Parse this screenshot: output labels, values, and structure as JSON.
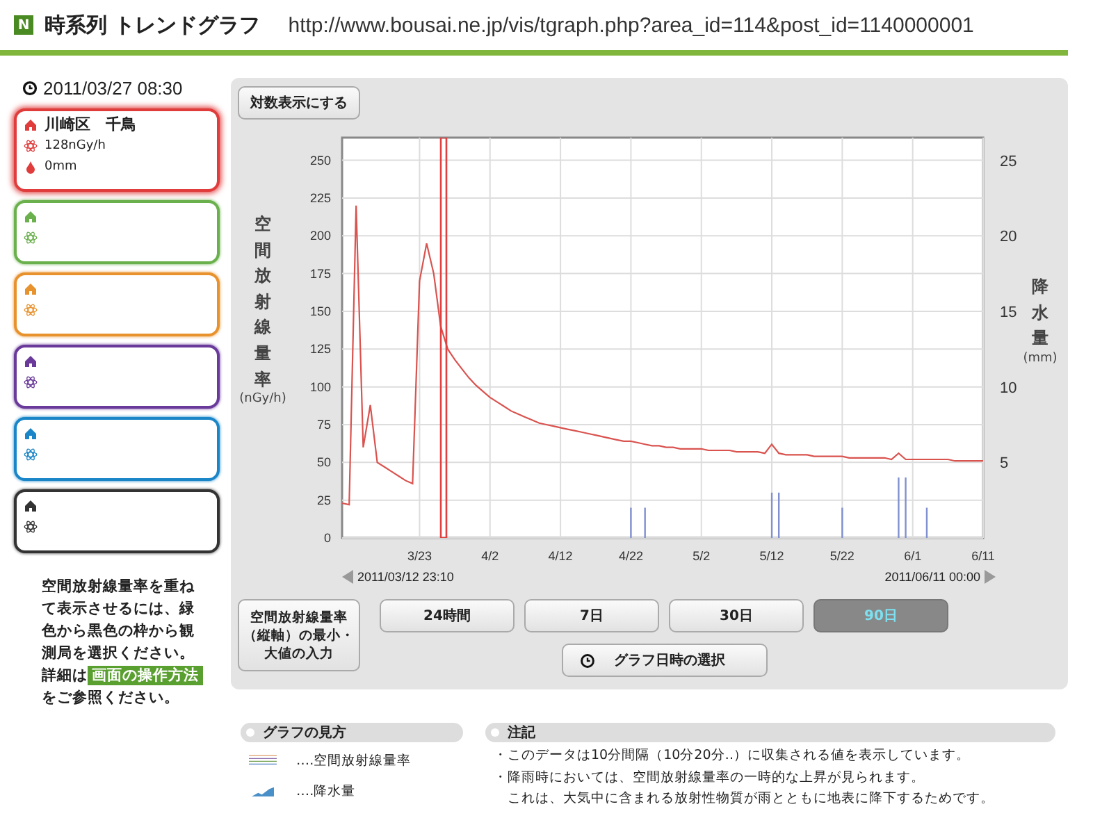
{
  "header": {
    "logo": "N",
    "title": "時系列 トレンドグラフ",
    "url": "http://www.bousai.ne.jp/vis/tgraph.php?area_id=114&post_id=1140000001"
  },
  "sidebar": {
    "datetime": "2011/03/27 08:30",
    "stations": [
      {
        "color": "#e03c3c",
        "selected": true,
        "name": "川崎区　千鳥",
        "rate": "128nGy/h",
        "rain": "0mm"
      },
      {
        "color": "#6ab04c",
        "selected": false
      },
      {
        "color": "#e8922e",
        "selected": false
      },
      {
        "color": "#6a3a9a",
        "selected": false
      },
      {
        "color": "#1a86c8",
        "selected": false
      },
      {
        "color": "#333333",
        "selected": false
      }
    ],
    "note": {
      "before": "空間放射線量率を重ねて表示させるには、緑色から黒色の枠から観測局を選択ください。詳細は",
      "link": "画面の操作方法",
      "after": "をご参照ください。"
    }
  },
  "panel": {
    "log_button": "対数表示にする",
    "ylabel": "空間放射線量率",
    "yunit": "(nGy/h)",
    "y2label": "降水量",
    "y2unit": "(mm)",
    "chart_data": {
      "type": "line",
      "grid": true,
      "categories": [
        null,
        null,
        null,
        null,
        null,
        null,
        null,
        null,
        null,
        null,
        null,
        "3/23",
        null,
        null,
        null,
        null,
        null,
        null,
        null,
        null,
        null,
        "4/2",
        null,
        null,
        null,
        null,
        null,
        null,
        null,
        null,
        null,
        "4/12",
        null,
        null,
        null,
        null,
        null,
        null,
        null,
        null,
        null,
        "4/22",
        null,
        null,
        null,
        null,
        null,
        null,
        null,
        null,
        null,
        "5/2",
        null,
        null,
        null,
        null,
        null,
        null,
        null,
        null,
        null,
        "5/12",
        null,
        null,
        null,
        null,
        null,
        null,
        null,
        null,
        null,
        "5/22",
        null,
        null,
        null,
        null,
        null,
        null,
        null,
        null,
        null,
        "6/1",
        null,
        null,
        null,
        null,
        null,
        null,
        null,
        null,
        null,
        "6/11"
      ],
      "series": [
        {
          "color": "#d9534f",
          "values": [
            23,
            22,
            220,
            60,
            88,
            50,
            47,
            44,
            41,
            38,
            36,
            170,
            195,
            175,
            140,
            125,
            118,
            112,
            106,
            101,
            97,
            93,
            90,
            87,
            84,
            82,
            80,
            78,
            76,
            75,
            74,
            73,
            72,
            71,
            70,
            69,
            68,
            67,
            66,
            65,
            64,
            64,
            63,
            62,
            61,
            61,
            60,
            60,
            59,
            59,
            59,
            59,
            58,
            58,
            58,
            58,
            57,
            57,
            57,
            57,
            56,
            62,
            56,
            55,
            55,
            55,
            55,
            54,
            54,
            54,
            54,
            54,
            53,
            53,
            53,
            53,
            53,
            53,
            52,
            56,
            52,
            52,
            52,
            52,
            52,
            52,
            52,
            51,
            51,
            51,
            51,
            51
          ]
        },
        {
          "color": "#8090d0",
          "type": "bar",
          "axis": "y2",
          "values": [
            null,
            null,
            null,
            null,
            null,
            null,
            null,
            null,
            null,
            null,
            null,
            null,
            null,
            null,
            null,
            null,
            null,
            null,
            null,
            null,
            null,
            null,
            null,
            null,
            null,
            null,
            null,
            null,
            null,
            null,
            null,
            null,
            null,
            null,
            null,
            null,
            null,
            null,
            null,
            null,
            null,
            2,
            null,
            2,
            null,
            null,
            null,
            null,
            null,
            null,
            null,
            null,
            null,
            null,
            null,
            null,
            null,
            null,
            null,
            null,
            null,
            3,
            3,
            null,
            null,
            null,
            null,
            null,
            null,
            null,
            null,
            2,
            null,
            null,
            null,
            null,
            null,
            null,
            null,
            4,
            4,
            null,
            null,
            2,
            null,
            null,
            null,
            null,
            null,
            null,
            null,
            null
          ]
        }
      ],
      "ylim": [
        0,
        265
      ],
      "yticks": [
        0,
        25,
        50,
        75,
        100,
        125,
        150,
        175,
        200,
        225,
        250
      ],
      "y2lim": [
        0,
        26.5
      ],
      "y2ticks": [
        5,
        10,
        15,
        20,
        25
      ]
    },
    "range_start": "2011/03/12 23:10",
    "range_end": "2011/06/11 00:00",
    "minmax_button": "空間放射線量率（縦軸）の最小・大値の入力",
    "periods": [
      {
        "label": "24時間",
        "selected": false
      },
      {
        "label": "7日",
        "selected": false
      },
      {
        "label": "30日",
        "selected": false
      },
      {
        "label": "90日",
        "selected": true
      }
    ],
    "date_button": "グラフ日時の選択"
  },
  "legend": {
    "title": "グラフの見方",
    "items": [
      {
        "kind": "line",
        "label": "‥‥空間放射線量率"
      },
      {
        "kind": "area",
        "label": "‥‥降水量"
      }
    ]
  },
  "notes": {
    "title": "注記",
    "items": [
      {
        "lines": [
          "・このデータは10分間隔（10分20分‥）に収集される値を表示しています。"
        ]
      },
      {
        "lines": [
          "・降雨時においては、空間放射線量率の一時的な上昇が見られます。",
          "これは、大気中に含まれる放射性物質が雨とともに地表に降下するためです。"
        ]
      }
    ]
  }
}
